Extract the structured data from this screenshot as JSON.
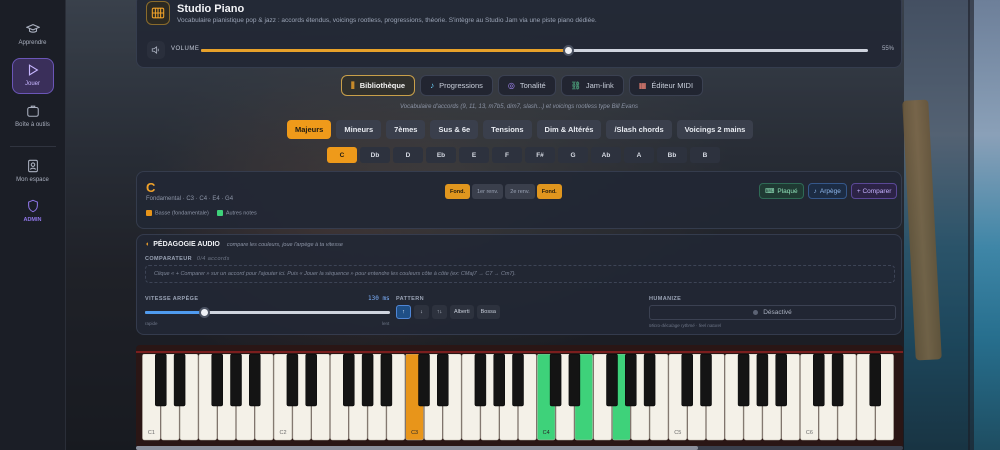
{
  "sidebar": {
    "items": [
      {
        "label": "Apprendre",
        "icon": "graduation-cap-icon"
      },
      {
        "label": "Jouer",
        "icon": "play-icon",
        "active": true
      },
      {
        "label": "Boîte à outils",
        "icon": "toolbox-icon"
      },
      {
        "label": "Mon espace",
        "icon": "user-icon"
      }
    ],
    "admin_label": "ADMIN"
  },
  "header": {
    "title": "Studio Piano",
    "subtitle": "Vocabulaire pianistique pop & jazz : accords étendus, voicings rootless, progressions, théorie. S'intègre au Studio Jam via une piste piano dédiée.",
    "volume_label": "VOLUME",
    "volume_percent": 55,
    "volume_value": "55%"
  },
  "tabs": [
    {
      "label": "Bibliothèque",
      "icon": "library-icon",
      "active": true
    },
    {
      "label": "Progressions",
      "icon": "music-note-icon"
    },
    {
      "label": "Tonalité",
      "icon": "compass-icon"
    },
    {
      "label": "Jam-link",
      "icon": "link-icon"
    },
    {
      "label": "Éditeur MIDI",
      "icon": "grid-icon"
    }
  ],
  "tab_description": "Vocabulaire d'accords (9, 11, 13, m7b5, dim7, slash...) et voicings rootless type Bill Evans",
  "categories": [
    {
      "label": "Majeurs",
      "active": true
    },
    {
      "label": "Mineurs"
    },
    {
      "label": "7èmes"
    },
    {
      "label": "Sus & 6e"
    },
    {
      "label": "Tensions"
    },
    {
      "label": "Dim & Altérés"
    },
    {
      "label": "/Slash chords"
    },
    {
      "label": "Voicings 2 mains"
    }
  ],
  "keys": [
    {
      "label": "C",
      "active": true
    },
    {
      "label": "Db"
    },
    {
      "label": "D"
    },
    {
      "label": "Eb"
    },
    {
      "label": "E"
    },
    {
      "label": "F"
    },
    {
      "label": "F#"
    },
    {
      "label": "G"
    },
    {
      "label": "Ab"
    },
    {
      "label": "A"
    },
    {
      "label": "Bb"
    },
    {
      "label": "B"
    }
  ],
  "chord": {
    "name": "C",
    "notes": "Fondamental · C3 · C4 · E4 · G4",
    "legend_bass": "Basse (fondamentale)",
    "legend_active": "Autres notes",
    "inversions": [
      {
        "label": "Fond.",
        "on": true
      },
      {
        "label": "1er renv."
      },
      {
        "label": "2e renv."
      },
      {
        "label": "Fond.",
        "on": true
      }
    ],
    "buttons": {
      "plaque": "Plaqué",
      "arpege": "Arpège",
      "comparer": "+ Comparer"
    }
  },
  "pedagogie": {
    "title": "PÉDAGOGIE AUDIO",
    "hint": "compare les couleurs, joue l'arpège à ta vitesse",
    "comparator_label": "COMPARATEUR",
    "comparator_count": "0/4 accords",
    "comparator_instruction": "Clique « + Comparer » sur un accord pour l'ajouter ici. Puis « Jouer la séquence » pour entendre les couleurs côte à côte (ex: CMaj7 → C7 → Cm7).",
    "speed_label": "VITESSE ARPÈGE",
    "speed_value": "130 ms",
    "speed_percent": 0.24,
    "speed_low": "rapide",
    "speed_high": "lent",
    "pattern_label": "PATTERN",
    "patterns": [
      {
        "label": "↑",
        "active": true
      },
      {
        "label": "↓"
      },
      {
        "label": "↑↓"
      },
      {
        "label": "Alberti"
      },
      {
        "label": "Bossa"
      }
    ],
    "humanize_label": "HUMANIZE",
    "humanize_value": "Désactivé",
    "humanize_note": "Micro-décalage rythmé · feel naturel"
  },
  "piano": {
    "octave_labels": [
      "C1",
      "C2",
      "C3",
      "C4",
      "C5",
      "C6"
    ],
    "highlight_bass": [
      "C3"
    ],
    "highlight_active": [
      "C4",
      "E4",
      "G4"
    ],
    "bass_color": "#e8951a",
    "active_color": "#3ed27a"
  }
}
